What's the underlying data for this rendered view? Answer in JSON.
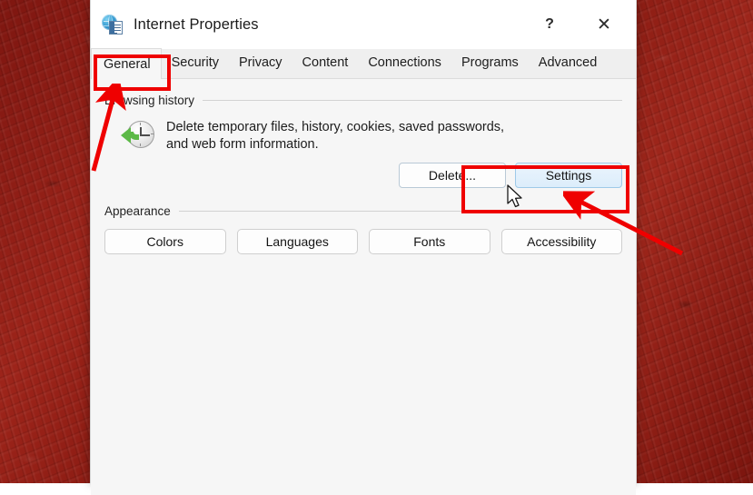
{
  "window": {
    "title": "Internet Properties",
    "icon": "internet-properties-icon",
    "help_button": "?",
    "close_button": "✕"
  },
  "tabs": [
    {
      "label": "General",
      "active": true
    },
    {
      "label": "Security",
      "active": false
    },
    {
      "label": "Privacy",
      "active": false
    },
    {
      "label": "Content",
      "active": false
    },
    {
      "label": "Connections",
      "active": false
    },
    {
      "label": "Programs",
      "active": false
    },
    {
      "label": "Advanced",
      "active": false
    }
  ],
  "browsing_history": {
    "group_label": "Browsing history",
    "icon": "history-clock-icon",
    "description_line1": "Delete temporary files, history, cookies, saved passwords,",
    "description_line2": "and web form information.",
    "delete_button": "Delete...",
    "settings_button": "Settings"
  },
  "appearance": {
    "group_label": "Appearance",
    "buttons": [
      {
        "label": "Colors"
      },
      {
        "label": "Languages"
      },
      {
        "label": "Fonts"
      },
      {
        "label": "Accessibility"
      }
    ]
  },
  "annotations": {
    "highlight_color": "#ef0000",
    "boxes": [
      {
        "target": "General tab"
      },
      {
        "target": "Settings button"
      }
    ],
    "arrows": [
      {
        "points_to": "General tab"
      },
      {
        "points_to": "Settings button"
      }
    ]
  },
  "cursor": {
    "type": "arrow-pointer",
    "over": "Settings button"
  },
  "desktop": {
    "background_color": "#8c1d16"
  }
}
